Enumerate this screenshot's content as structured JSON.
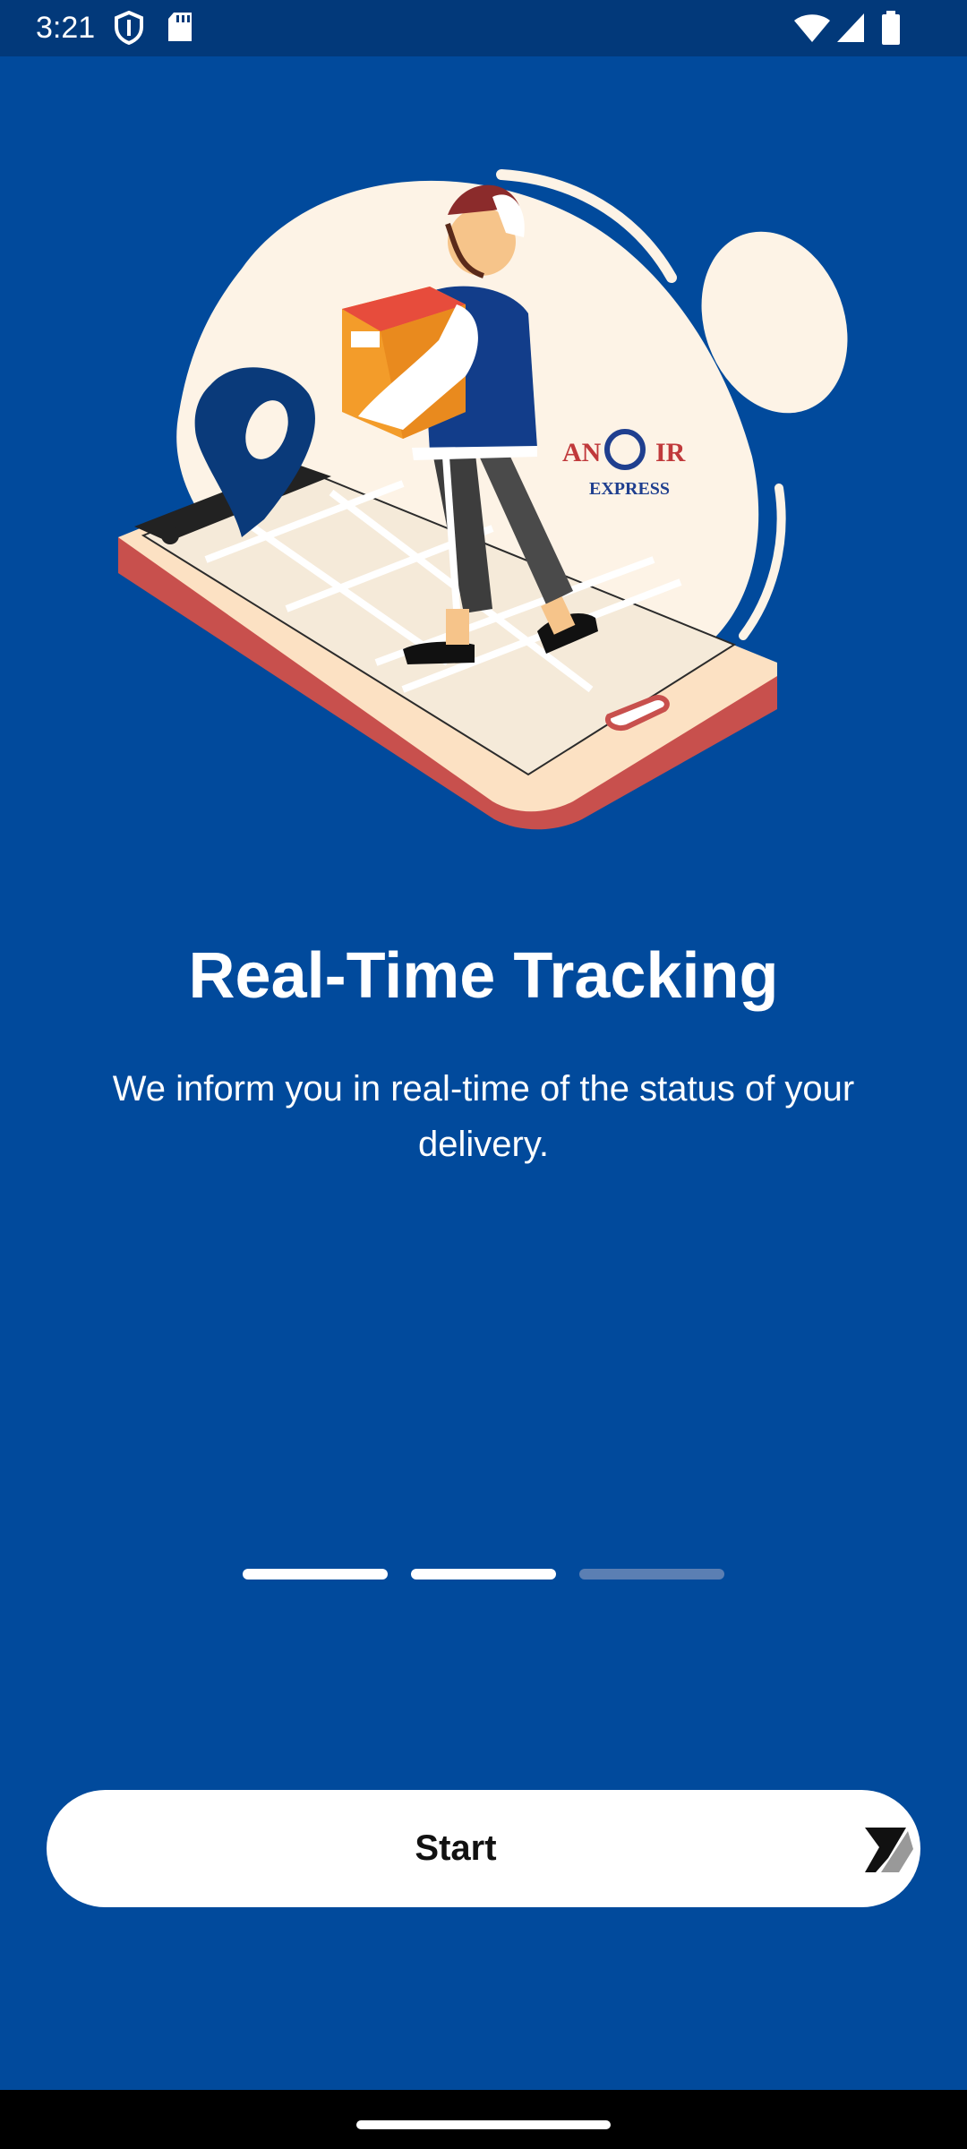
{
  "status_bar": {
    "time": "3:21",
    "icons": [
      "shield-icon",
      "sd-card-icon",
      "wifi-icon",
      "signal-icon",
      "battery-icon"
    ]
  },
  "illustration": {
    "logo_text_top_left": "AN",
    "logo_text_top_right": "IR",
    "logo_text_bottom": "EXPRESS"
  },
  "onboarding": {
    "title": "Real-Time Tracking",
    "description": "We inform you in real-time of the status of your delivery."
  },
  "pager": {
    "total": 3,
    "current": 2
  },
  "start_button": {
    "label": "Start",
    "icon": "pencil-arrow-icon"
  },
  "colors": {
    "background": "#014a9c",
    "status_bar": "#02397a",
    "button": "#ffffff",
    "indicator_active": "#ffffff",
    "indicator_inactive": "#5b7fb3"
  }
}
